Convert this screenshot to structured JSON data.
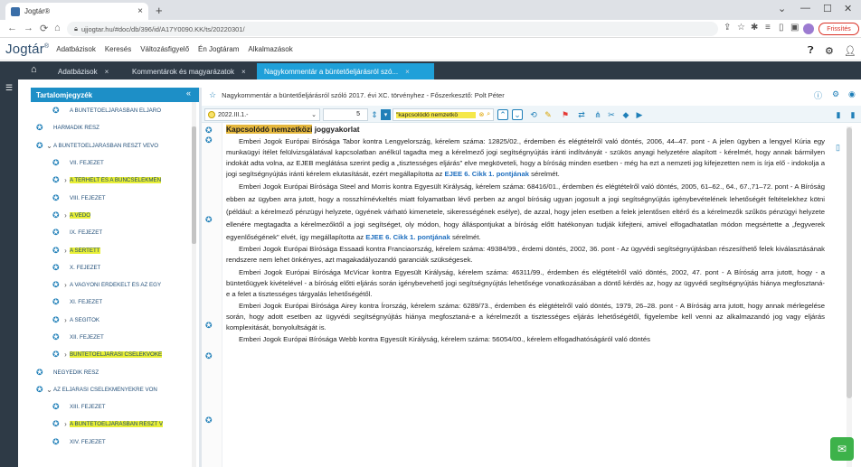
{
  "browser": {
    "tab_title": "Jogtár®",
    "new_tab": "+",
    "url": "ujjogtar.hu/#doc/db/396/id/A17Y0090.KK/ts/20220301/",
    "update_button": "Frissítés"
  },
  "app": {
    "logo": "Jogtár",
    "logo_mark": "®",
    "menu": [
      "Adatbázisok",
      "Keresés",
      "Változásfigyelő",
      "Én Jogtáram",
      "Alkalmazások"
    ]
  },
  "doc_tabs": [
    {
      "label": "Adatbázisok",
      "active": false
    },
    {
      "label": "Kommentárok és magyarázatok",
      "active": false
    },
    {
      "label": "Nagykommentár a büntetőeljárásról szó...",
      "active": true
    }
  ],
  "sidebar": {
    "title": "Tartalomjegyzék",
    "items": [
      {
        "label": "A BÜNTETŐELJÁRÁSBAN ELJÁRÓ",
        "caret": "",
        "indent": 1,
        "highlight": false
      },
      {
        "label": "HARMADIK RÉSZ",
        "caret": "",
        "indent": 0,
        "highlight": false
      },
      {
        "label": "A BÜNTETŐELJÁRÁSBAN RÉSZT VEVŐ",
        "caret": "⌄",
        "indent": 0,
        "highlight": false
      },
      {
        "label": "VII. FEJEZET",
        "caret": "",
        "indent": 1,
        "highlight": false
      },
      {
        "label": "A TERHELT ÉS A BŰNCSELEKMÉN",
        "caret": "›",
        "indent": 1,
        "highlight": true
      },
      {
        "label": "VIII. FEJEZET",
        "caret": "",
        "indent": 1,
        "highlight": false
      },
      {
        "label": "A VÉDŐ",
        "caret": "›",
        "indent": 1,
        "highlight": true
      },
      {
        "label": "IX. FEJEZET",
        "caret": "",
        "indent": 1,
        "highlight": false
      },
      {
        "label": "A SÉRTETT",
        "caret": "›",
        "indent": 1,
        "highlight": true
      },
      {
        "label": "X. FEJEZET",
        "caret": "",
        "indent": 1,
        "highlight": false
      },
      {
        "label": "A VAGYONI ÉRDEKELT ÉS AZ EGY",
        "caret": "›",
        "indent": 1,
        "highlight": false
      },
      {
        "label": "XI. FEJEZET",
        "caret": "",
        "indent": 1,
        "highlight": false
      },
      {
        "label": "A SEGÍTŐK",
        "caret": "›",
        "indent": 1,
        "highlight": false
      },
      {
        "label": "XII. FEJEZET",
        "caret": "",
        "indent": 1,
        "highlight": false
      },
      {
        "label": "BÜNTETŐELJÁRÁSI CSELEKVŐKÉ",
        "caret": "›",
        "indent": 1,
        "highlight": true
      },
      {
        "label": "NEGYEDIK RÉSZ",
        "caret": "",
        "indent": 0,
        "highlight": false
      },
      {
        "label": "AZ ELJÁRÁSI CSELEKMÉNYEKRE VON",
        "caret": "⌄",
        "indent": 0,
        "highlight": false
      },
      {
        "label": "XIII. FEJEZET",
        "caret": "",
        "indent": 1,
        "highlight": false
      },
      {
        "label": "A BÜNTETŐELJÁRÁSBAN RÉSZT V",
        "caret": "›",
        "indent": 1,
        "highlight": true
      },
      {
        "label": "XIV. FEJEZET",
        "caret": "",
        "indent": 1,
        "highlight": false
      }
    ]
  },
  "document": {
    "breadcrumb": "Nagykommentár a büntetőeljárásról szóló 2017. évi XC. törvényhez - Főszerkesztő: Polt Péter",
    "version": "2022.III.1.-",
    "page_number": "5",
    "search_value": "\"kapcsolódó nemzetkö",
    "heading_highlight": "Kapcsolódó nemzetközi",
    "heading_rest": " joggyakorlat",
    "paragraphs": [
      {
        "text": "Emberi Jogok Európai Bírósága Tabor kontra Lengyelország, kérelem száma: 12825/02., érdemben és elégtételről való döntés, 2006, 44–47. pont - A jelen ügyben a lengyel Kúria egy munkaügyi ítélet felülvizsgálatával kapcsolatban anélkül tagadta meg a kérelmező jogi segítségnyújtás iránti indítványát - szükös anyagi helyzetére alapított - kérelmét, hogy annak bármilyen indokát adta volna, az EJEB meglátása szerint pedig a „tisztességes eljárás” elve megköveteli, hogy a bíróság minden esetben - még ha ezt a nemzeti jog kifejezetten nem is írja elő - indokolja a jogi segítségnyújtás iránti kérelem elutasítását, ezért megállapította az ",
        "link": "EJEE 6. Cikk 1. pontjának",
        "tail": " sérelmét."
      },
      {
        "text": "Emberi Jogok Európai Bírósága Steel and Morris kontra Egyesült Királyság, kérelem száma: 68416/01., érdemben és elégtételről való döntés, 2005, 61–62., 64., 67.,71–72. pont - A Bíróság ebben az ügyben arra jutott, hogy a rosszhírnévkeltés miatt folyamatban lévő perben az angol bíróság ugyan jogosult a jogi segítségnyújtás igénybevételének lehetőségét feltételekhez kötni (például: a kérelmező pénzügyi helyzete, ügyének várható kimenetele, sikerességének esélye), de azzal, hogy jelen esetben a felek jelentősen eltérő és a kérelmezők szűkös pénzügyi helyzete ellenére megtagadta a kérelmezőktől a jogi segítséget, oly módon, hogy álláspontjukat a bíróság előtt hatékonyan tudják kifejteni, amivel elfogadhatatlan módon megsértette a „fegyverek egyenlőségének” elvét, így megállapította az ",
        "link": "EJEE 6. Cikk 1. pontjának",
        "tail": " sérelmét."
      },
      {
        "text": "Emberi Jogok Európai Bírósága Essaadi kontra Franciaország, kérelem száma: 49384/99., érdemi döntés, 2002, 36. pont - Az ügyvédi segítségnyújtásban részesíthető felek kiválasztásának rendszere nem lehet önkényes, azt magakadályozandó garanciák szükségesek.",
        "link": "",
        "tail": ""
      },
      {
        "text": "Emberi Jogok Európai Bírósága McVicar kontra Egyesült Királyság, kérelem száma: 46311/99., érdemben és elégtételről való döntés, 2002, 47. pont - A Bíróság arra jutott, hogy - a büntetőügyek kivételével - a bíróság előtti eljárás során igénybevehető jogi segítségnyújtás lehetősége vonatkozásában a döntő kérdés az, hogy az ügyvédi segítségnyújtás hiánya megfosztaná-e a felet a tisztességes tárgyalás lehetőségétől.",
        "link": "",
        "tail": ""
      },
      {
        "text": "Emberi Jogok Európai Bírósága Airey kontra Írország, kérelem száma: 6289/73., érdemben és elégtételről való döntés, 1979, 26–28. pont - A Bíróság arra jutott, hogy annak mérlegelése során, hogy adott esetben az ügyvédi segítségnyújtás hiánya megfosztaná-e a kérelmezőt a tisztességes eljárás lehetőségétől, figyelembe kell venni az alkalmazandó jog vagy eljárás komplexitását, bonyolultságát is.",
        "link": "",
        "tail": ""
      },
      {
        "text": "Emberi Jogok Európai Bírósága Webb kontra Egyesült Királyság, kérelem száma: 56054/00., kérelem elfogadhatóságáról való döntés",
        "link": "",
        "tail": ""
      }
    ]
  },
  "colors": {
    "accent": "#1fa0d9",
    "nav_dark": "#2e3a46",
    "highlight_yellow": "#e8ef36",
    "heading_highlight": "#e5b83e",
    "link": "#1f6fbf"
  }
}
